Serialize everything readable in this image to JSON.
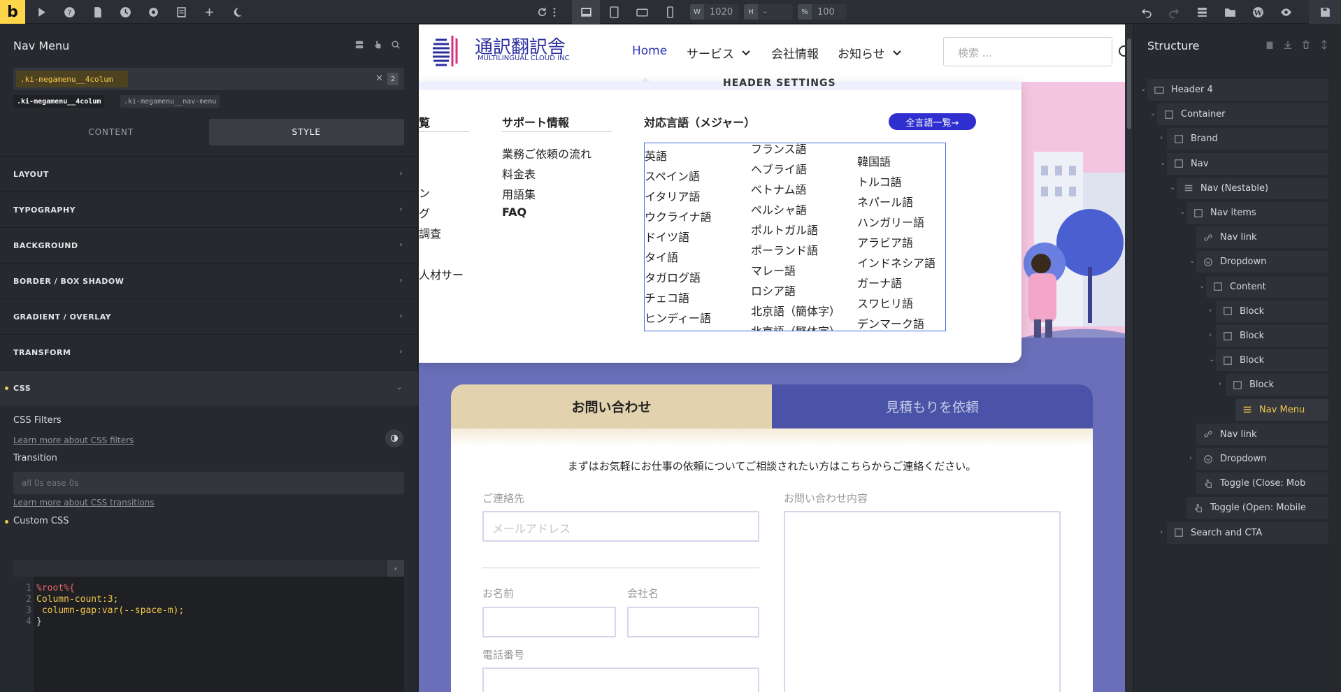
{
  "toolbar": {
    "logo": "b",
    "width_label": "W",
    "width_value": "1020",
    "height_label": "H",
    "height_value": "-",
    "zoom_label": "%",
    "zoom_value": "100"
  },
  "left_panel": {
    "title": "Nav Menu",
    "selector": "ki-megamenu__4colum",
    "selector_count": "2",
    "class_tags": [
      ".ki-megamenu__4colum",
      ".ki-megamenu__nav-menu"
    ],
    "tabs": [
      "CONTENT",
      "STYLE"
    ],
    "sections": [
      "LAYOUT",
      "TYPOGRAPHY",
      "BACKGROUND",
      "BORDER / BOX SHADOW",
      "GRADIENT / OVERLAY",
      "TRANSFORM",
      "CSS"
    ],
    "css_filters_label": "CSS Filters",
    "css_filters_link": "Learn more about CSS filters",
    "transition_label": "Transition",
    "transition_placeholder": "all 0s ease 0s",
    "transition_link": "Learn more about CSS transitions",
    "custom_css_label": "Custom CSS",
    "code_lines": [
      "%root%{",
      "Column-count:3;",
      " column-gap:var(--space-m);",
      "}"
    ],
    "line_numbers": [
      "1",
      "2",
      "3",
      "4"
    ]
  },
  "site": {
    "brand_name": "通訳翻訳舎",
    "brand_sub": "MULTILINGUAL CLOUD INC",
    "nav": [
      "Home",
      "サービス",
      "会社情報",
      "お知らせ"
    ],
    "search_placeholder": "検索 ...",
    "header_settings": "HEADER SETTINGS",
    "mega": {
      "col1_heading": "覧",
      "col1_items": [
        "ン",
        "グ",
        "調査",
        "人材サー"
      ],
      "col2_heading": "サポート情報",
      "col2_items": [
        "業務ご依頼の流れ",
        "料金表",
        "用語集",
        "FAQ"
      ],
      "col3_heading": "対応言語（メジャー）",
      "all_button": "全言語一覧→",
      "languages_col1": [
        "英語",
        "スペイン語",
        "イタリア語",
        "ウクライナ語",
        "ドイツ語",
        "タイ語",
        "タガログ語",
        "チェコ語",
        "ヒンディー語"
      ],
      "languages_col2": [
        "フランス語",
        "ヘブライ語",
        "ベトナム語",
        "ペルシャ語",
        "ポルトガル語",
        "ポーランド語",
        "マレー語",
        "ロシア語",
        "北京語（簡体字）",
        "北京語（繁体字）"
      ],
      "languages_col3": [
        "韓国語",
        "トルコ語",
        "ネパール語",
        "ハンガリー語",
        "アラビア語",
        "インドネシア語",
        "ガーナ語",
        "スワヒリ語",
        "デンマーク語"
      ]
    },
    "form": {
      "tab_contact": "お問い合わせ",
      "tab_quote": "見積もりを依頼",
      "message": "まずはお気軽にお仕事の依頼についてご相談されたい方はこちらからご連絡ください。",
      "contact_label": "ご連絡先",
      "email_placeholder": "メールアドレス",
      "inquiry_label": "お問い合わせ内容",
      "name_label": "お名前",
      "company_label": "会社名",
      "phone_label": "電話番号"
    }
  },
  "right_panel": {
    "title": "Structure",
    "tree": [
      "Header 4",
      "Container",
      "Brand",
      "Nav",
      "Nav (Nestable)",
      "Nav items",
      "Nav link",
      "Dropdown",
      "Content",
      "Block",
      "Block",
      "Block",
      "Block",
      "Nav Menu",
      "Nav link",
      "Dropdown",
      "Toggle (Close: Mob",
      "Toggle (Open: Mobile",
      "Search and CTA"
    ]
  },
  "colors": {
    "accent": "#f3c84a",
    "brand_blue": "#2b33b6",
    "panel": "#26292e"
  }
}
